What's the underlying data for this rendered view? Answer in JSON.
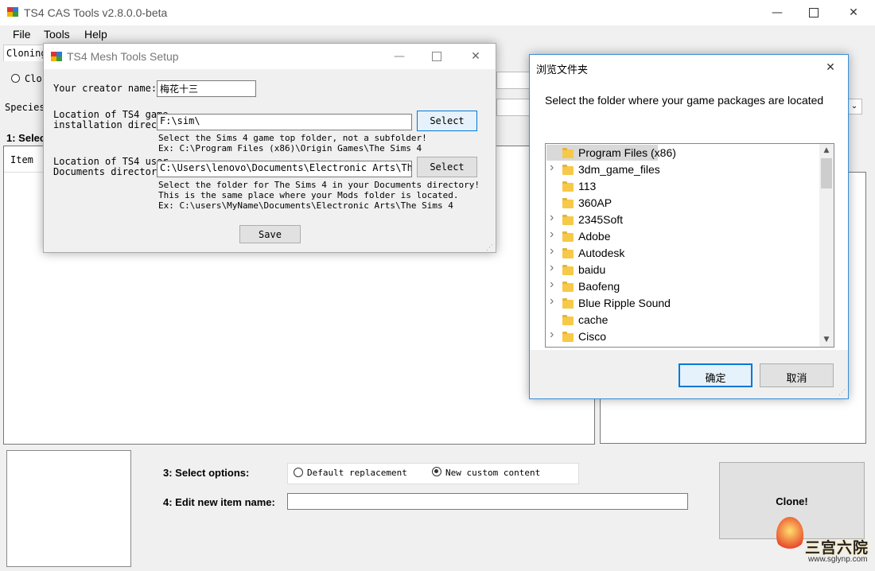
{
  "main_window": {
    "title": "TS4 CAS Tools v2.8.0.0-beta",
    "menu": [
      "File",
      "Tools",
      "Help"
    ],
    "cloning_label": "Cloning",
    "clone_radio_label": "Clo",
    "species_label": "Species",
    "select_label": "1: Selec",
    "item_column": "Item",
    "select_options_label": "3: Select options:",
    "option_default": "Default replacement",
    "option_new": "New custom content",
    "selected_option": "New custom content",
    "edit_name_label": "4: Edit new item name:",
    "item_name_value": "",
    "clone_button": "Clone!"
  },
  "setup_dialog": {
    "title": "TS4 Mesh Tools Setup",
    "creator_label": "Your creator name:",
    "creator_value": "梅花十三",
    "game_location_label_1": "Location of TS4 game",
    "game_location_label_2": "installation directo",
    "game_location_value": "F:\\sim\\",
    "select_button": "Select",
    "game_hint_1": "Select the Sims 4 game top folder, not a subfolder!",
    "game_hint_2": "Ex: C:\\Program Files (x86)\\Origin Games\\The Sims 4",
    "docs_location_label_1": "Location of TS4 user",
    "docs_location_label_2": "Documents directory",
    "docs_location_value": "C:\\Users\\lenovo\\Documents\\Electronic Arts\\The S",
    "docs_hint_1": "Select the folder for The Sims 4 in your Documents directory!",
    "docs_hint_2": "This is the same place where your Mods folder is located.",
    "docs_hint_3": "Ex: C:\\users\\MyName\\Documents\\Electronic Arts\\The Sims 4",
    "save_button": "Save"
  },
  "browse_dialog": {
    "title": "浏览文件夹",
    "description": "Select the folder where your game packages are located",
    "folders": [
      {
        "name": "Program Files (x86)",
        "expandable": false,
        "selected": true
      },
      {
        "name": "3dm_game_files",
        "expandable": true,
        "selected": false
      },
      {
        "name": "113",
        "expandable": false,
        "selected": false
      },
      {
        "name": "360AP",
        "expandable": false,
        "selected": false
      },
      {
        "name": "2345Soft",
        "expandable": true,
        "selected": false
      },
      {
        "name": "Adobe",
        "expandable": true,
        "selected": false
      },
      {
        "name": "Autodesk",
        "expandable": true,
        "selected": false
      },
      {
        "name": "baidu",
        "expandable": true,
        "selected": false
      },
      {
        "name": "Baofeng",
        "expandable": true,
        "selected": false
      },
      {
        "name": "Blue Ripple Sound",
        "expandable": true,
        "selected": false
      },
      {
        "name": "cache",
        "expandable": false,
        "selected": false
      },
      {
        "name": "Cisco",
        "expandable": true,
        "selected": false
      }
    ],
    "ok_button": "确定",
    "cancel_button": "取消"
  },
  "watermark": {
    "brand": "三宫六院",
    "url": "www.sglynp.com"
  },
  "icons": {
    "app_icon": "app-icon",
    "minimize": "minimize-icon",
    "maximize": "maximize-icon",
    "close": "close-icon"
  },
  "colors": {
    "focus_blue": "#0078d7",
    "selection_gray": "#cce8ff",
    "folder_yellow": "#f7c948"
  }
}
